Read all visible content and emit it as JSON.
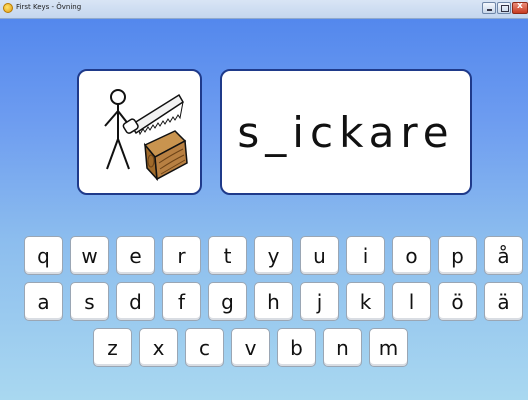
{
  "window": {
    "title": "First Keys - Övning"
  },
  "exercise": {
    "word": "s_ickare",
    "symbol_icon": "person-with-saw-and-wood-icon"
  },
  "keyboard": {
    "row1": [
      "q",
      "w",
      "e",
      "r",
      "t",
      "y",
      "u",
      "i",
      "o",
      "p",
      "å"
    ],
    "row2": [
      "a",
      "s",
      "d",
      "f",
      "g",
      "h",
      "j",
      "k",
      "l",
      "ö",
      "ä"
    ],
    "row3": [
      "z",
      "x",
      "c",
      "v",
      "b",
      "n",
      "m"
    ]
  },
  "colors": {
    "background_top": "#4f84ec",
    "background_bottom": "#a9d8f0",
    "card_border": "#1f3a8a"
  }
}
